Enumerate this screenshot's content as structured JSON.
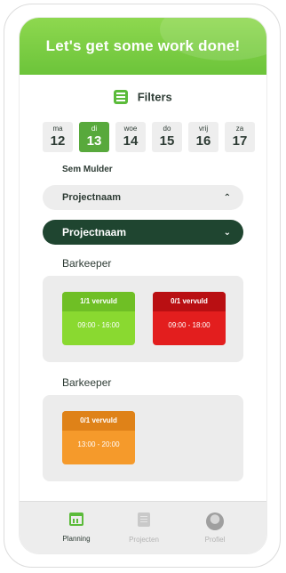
{
  "header": {
    "title": "Let's get some work done!"
  },
  "filters": {
    "label": "Filters",
    "icon": "filter-list-icon"
  },
  "days": [
    {
      "name": "ma",
      "num": "12",
      "active": false
    },
    {
      "name": "di",
      "num": "13",
      "active": true
    },
    {
      "name": "woe",
      "num": "14",
      "active": false
    },
    {
      "name": "do",
      "num": "15",
      "active": false
    },
    {
      "name": "vrij",
      "num": "16",
      "active": false
    },
    {
      "name": "za",
      "num": "17",
      "active": false
    }
  ],
  "person": "Sem Mulder",
  "project_filter": {
    "label": "Projectnaam",
    "chevron": "chevron-up-icon"
  },
  "project": {
    "label": "Projectnaam",
    "chevron": "chevron-down-icon"
  },
  "groups": [
    {
      "role": "Barkeeper",
      "shifts": [
        {
          "status": "1/1 vervuld",
          "time": "09:00 - 16:00",
          "color": "green"
        },
        {
          "status": "0/1 vervuld",
          "time": "09:00 - 18:00",
          "color": "red"
        }
      ]
    },
    {
      "role": "Barkeeper",
      "shifts": [
        {
          "status": "0/1 vervuld",
          "time": "13:00 - 20:00",
          "color": "orange"
        }
      ]
    }
  ],
  "nav": [
    {
      "label": "Planning",
      "icon": "calendar-icon",
      "active": true
    },
    {
      "label": "Projecten",
      "icon": "document-icon",
      "active": false
    },
    {
      "label": "Profiel",
      "icon": "avatar-icon",
      "active": false
    }
  ],
  "colors": {
    "brand_green": "#6cc43a",
    "dark_green": "#1f4530"
  }
}
